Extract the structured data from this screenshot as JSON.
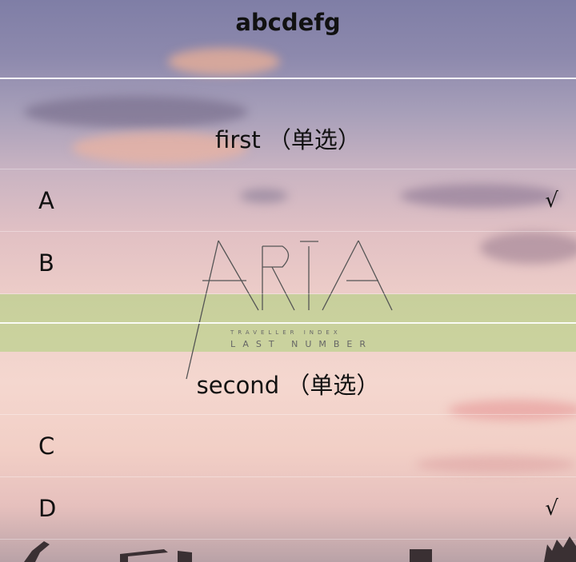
{
  "header": {
    "title": "abcdefg"
  },
  "questions": [
    {
      "title": "first （单选）",
      "options": [
        {
          "label": "A",
          "mark": "√"
        },
        {
          "label": "B",
          "mark": ""
        }
      ]
    },
    {
      "title": "second （单选）",
      "options": [
        {
          "label": "C",
          "mark": ""
        },
        {
          "label": "D",
          "mark": "√"
        }
      ]
    }
  ],
  "logo": {
    "text": "ARIA",
    "subtitle_small": "TRAVELLER INDEX",
    "subtitle": "LAST NUMBER"
  },
  "colors": {
    "text": "#111111",
    "divider": "#ffffff",
    "accent_band": "#aad278"
  }
}
